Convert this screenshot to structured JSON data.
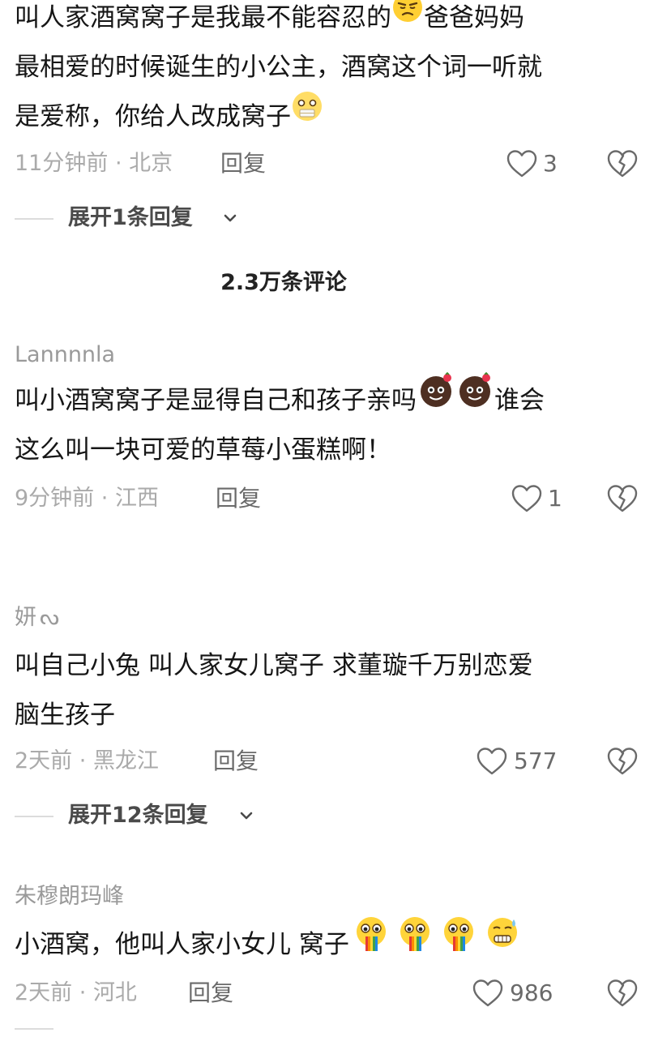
{
  "section_title": "2.3万条评论",
  "comments": [
    {
      "username": "",
      "lines": [
        "叫人家酒窝窝子是我最不能容忍的",
        "最相爱的时候诞生的小公主，酒窝这个词一听就",
        "是爱称，你给人改成窝子"
      ],
      "line1_suffix": "爸爸妈妈",
      "emojis": [
        "annoyed-emoji-icon",
        "mouth-covered-emoji-icon"
      ],
      "time": "11分钟前",
      "location": "北京",
      "reply_label": "回复",
      "likes": "3",
      "expand_label": "展开1条回复"
    },
    {
      "username": "Lannnnla",
      "lines": [
        "叫小酒窝窝子是显得自己和孩子亲吗",
        "这么叫一块可爱的草莓小蛋糕啊！"
      ],
      "line1_suffix": "谁会",
      "emojis": [
        "chocolate-cake-emoji-icon",
        "chocolate-cake-emoji-icon"
      ],
      "time": "9分钟前",
      "location": "江西",
      "reply_label": "回复",
      "likes": "1"
    },
    {
      "username": "妍",
      "username_suffix": "ᔓ",
      "lines": [
        "叫自己小兔  叫人家女儿窝子  求董璇千万别恋爱",
        "脑生孩子"
      ],
      "time": "2天前",
      "location": "黑龙江",
      "reply_label": "回复",
      "likes": "577",
      "expand_label": "展开12条回复"
    },
    {
      "username": "朱穆朗玛峰",
      "lines": [
        "小酒窝，他叫人家小女儿 窝子"
      ],
      "emojis": [
        "rainbow-vomit-emoji-icon",
        "rainbow-vomit-emoji-icon",
        "rainbow-vomit-emoji-icon",
        "sweat-grimace-emoji-icon"
      ],
      "time": "2天前",
      "location": "河北",
      "reply_label": "回复",
      "likes": "986"
    }
  ],
  "meta_separator": " · ",
  "colors": {
    "text": "#161616",
    "meta": "#aaaaaa",
    "username": "#9a9a9a",
    "action": "#6a6a6a",
    "divider": "#dcdcdc"
  }
}
